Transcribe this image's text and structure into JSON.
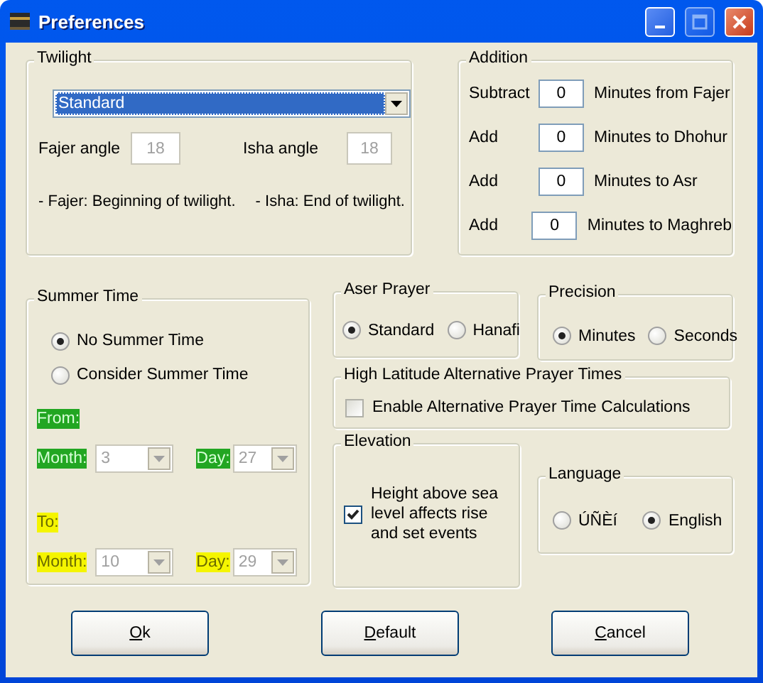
{
  "window": {
    "title": "Preferences"
  },
  "twilight": {
    "title": "Twilight",
    "method": "Standard",
    "fajer_label": "Fajer angle",
    "fajer_value": "18",
    "fajer_disabled": true,
    "isha_label": "Isha angle",
    "isha_value": "18",
    "isha_disabled": true,
    "fajer_note": "- Fajer: Beginning of twilight.",
    "isha_note": "- Isha: End of twilight."
  },
  "addition": {
    "title": "Addition",
    "rows": [
      {
        "label": "Subtract",
        "value": "0",
        "text": "Minutes from Fajer"
      },
      {
        "label": "Add",
        "value": "0",
        "text": "Minutes to Dhohur"
      },
      {
        "label": "Add",
        "value": "0",
        "text": "Minutes to Asr"
      },
      {
        "label": "Add",
        "value": "0",
        "text": "Minutes to Maghreb"
      }
    ]
  },
  "summer_time": {
    "title": "Summer Time",
    "options": [
      {
        "label": "No Summer Time",
        "selected": true
      },
      {
        "label": "Consider Summer Time",
        "selected": false
      }
    ],
    "periods": [
      {
        "kind": "from",
        "title": "From:",
        "month_label": "Month:",
        "month": "3",
        "day_label": "Day:",
        "day": "27",
        "disabled": true
      },
      {
        "kind": "to",
        "title": "To:",
        "month_label": "Month:",
        "month": "10",
        "day_label": "Day:",
        "day": "29",
        "disabled": true
      }
    ]
  },
  "aser_prayer": {
    "title": "Aser Prayer",
    "options": [
      {
        "label": "Standard",
        "selected": true
      },
      {
        "label": "Hanafi",
        "selected": false
      }
    ]
  },
  "precision": {
    "title": "Precision",
    "options": [
      {
        "label": "Minutes",
        "selected": true
      },
      {
        "label": "Seconds",
        "selected": false
      }
    ]
  },
  "high_latitude": {
    "title": "High Latitude Alternative Prayer Times",
    "label": "Enable Alternative Prayer Time Calculations",
    "checked": false
  },
  "elevation": {
    "title": "Elevation",
    "label": "Height above sea level affects rise and set events",
    "checked": true
  },
  "language": {
    "title": "Language",
    "options": [
      {
        "label": "ÚÑÈí",
        "selected": false
      },
      {
        "label": "English",
        "selected": true
      }
    ]
  },
  "buttons": [
    {
      "label": "Ok"
    },
    {
      "label": "Default"
    },
    {
      "label": "Cancel"
    }
  ]
}
